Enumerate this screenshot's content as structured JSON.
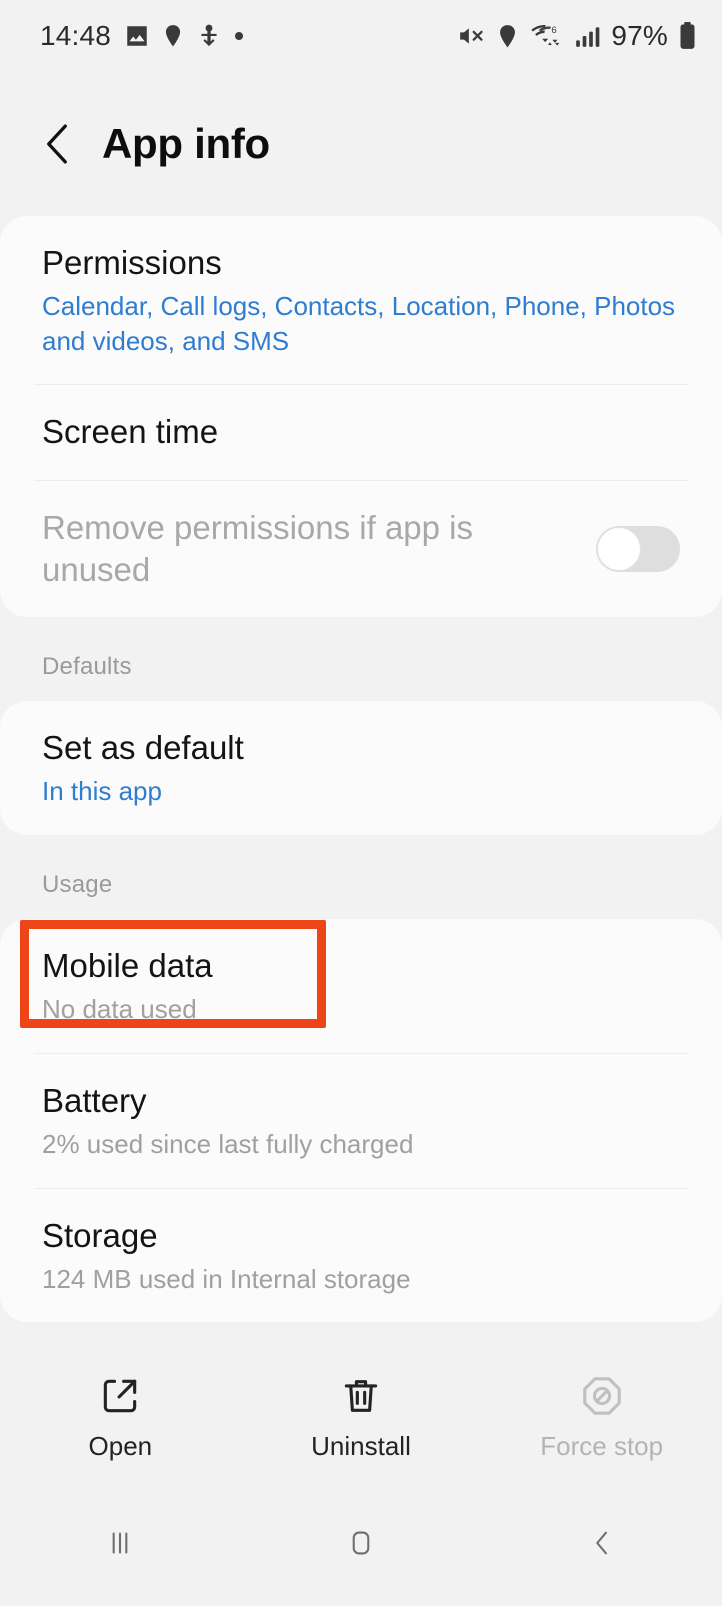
{
  "status_bar": {
    "time": "14:48",
    "battery_percent": "97%",
    "left_icons": [
      "image-icon",
      "location-pin-icon",
      "download-anchor-icon",
      "dot-icon"
    ],
    "right_icons": [
      "mute-icon",
      "location-pin-icon",
      "wifi-6-icon",
      "signal-bars-icon",
      "battery-icon"
    ]
  },
  "header": {
    "title": "App info",
    "back_icon": "chevron-left-icon"
  },
  "permissions_card": {
    "rows": [
      {
        "title": "Permissions",
        "subtitle": "Calendar, Call logs, Contacts, Location, Phone, Photos and videos, and SMS",
        "subtitle_color": "#2f7dd1"
      },
      {
        "title": "Screen time",
        "subtitle": ""
      },
      {
        "title": "Remove permissions if app is unused",
        "subtitle": "",
        "disabled": true,
        "toggle_state": "off"
      }
    ]
  },
  "defaults_section": {
    "label": "Defaults",
    "rows": [
      {
        "title": "Set as default",
        "subtitle": "In this app",
        "subtitle_color": "#2f7dd1"
      }
    ]
  },
  "usage_section": {
    "label": "Usage",
    "rows": [
      {
        "title": "Mobile data",
        "subtitle": "No data used",
        "highlighted": true
      },
      {
        "title": "Battery",
        "subtitle": "2% used since last fully charged"
      },
      {
        "title": "Storage",
        "subtitle": "124 MB used in Internal storage"
      }
    ]
  },
  "action_bar": {
    "actions": [
      {
        "label": "Open",
        "icon": "open-external-icon",
        "disabled": false
      },
      {
        "label": "Uninstall",
        "icon": "trash-icon",
        "disabled": false
      },
      {
        "label": "Force stop",
        "icon": "block-octagon-icon",
        "disabled": true
      }
    ]
  },
  "nav_bar": {
    "buttons": [
      {
        "name": "recents-button",
        "icon": "recents-icon"
      },
      {
        "name": "home-button",
        "icon": "home-square-icon"
      },
      {
        "name": "back-button",
        "icon": "chevron-left-icon"
      }
    ]
  },
  "highlight": {
    "color": "#ed4418",
    "target": "Mobile data"
  }
}
